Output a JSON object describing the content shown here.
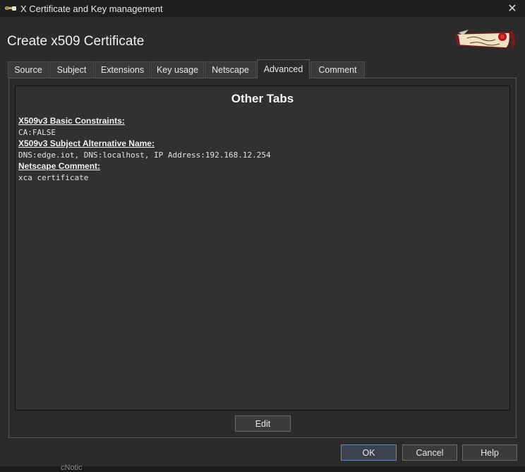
{
  "window": {
    "title": "X Certificate and Key management",
    "close_glyph": "✕"
  },
  "dialog": {
    "heading": "Create x509 Certificate"
  },
  "tabs": [
    {
      "label": "Source"
    },
    {
      "label": "Subject"
    },
    {
      "label": "Extensions"
    },
    {
      "label": "Key usage"
    },
    {
      "label": "Netscape"
    },
    {
      "label": "Advanced"
    },
    {
      "label": "Comment"
    }
  ],
  "active_tab": "Advanced",
  "advanced": {
    "heading": "Other Tabs",
    "extensions": [
      {
        "title": "X509v3 Basic Constraints:",
        "value": "CA:FALSE"
      },
      {
        "title": "X509v3 Subject Alternative Name:",
        "value": "DNS:edge.iot, DNS:localhost, IP Address:192.168.12.254"
      },
      {
        "title": "Netscape Comment:",
        "value": "xca certificate"
      }
    ],
    "edit_label": "Edit"
  },
  "buttons": {
    "ok": "OK",
    "cancel": "Cancel",
    "help": "Help"
  },
  "background_window_text": "cNotic"
}
